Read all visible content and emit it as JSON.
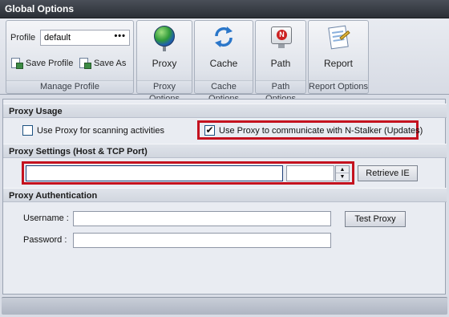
{
  "window": {
    "title": "Global Options"
  },
  "ribbon": {
    "manage_profile": {
      "profile_label": "Profile",
      "profile_value": "default",
      "browse_label": "•••",
      "save_profile_label": "Save Profile",
      "save_as_label": "Save As",
      "group_label": "Manage Profile"
    },
    "proxy": {
      "button_label": "Proxy",
      "group_label": "Proxy Options",
      "icon": "globe-icon"
    },
    "cache": {
      "button_label": "Cache",
      "group_label": "Cache Options",
      "icon": "refresh-arrows-icon"
    },
    "path": {
      "button_label": "Path",
      "group_label": "Path Options",
      "icon": "monitor-icon"
    },
    "report": {
      "button_label": "Report",
      "group_label": "Report Options",
      "icon": "document-pen-icon"
    }
  },
  "proxy_usage": {
    "heading": "Proxy Usage",
    "scanning": {
      "label": "Use Proxy for scanning activities",
      "checked": false
    },
    "updates": {
      "label": "Use Proxy to communicate with N-Stalker (Updates)",
      "checked": true,
      "check_glyph": "✔"
    }
  },
  "proxy_settings": {
    "heading": "Proxy Settings (Host & TCP Port)",
    "host_value": "",
    "port_value": "",
    "spinner_up": "▲",
    "spinner_down": "▼",
    "retrieve_ie_label": "Retrieve IE"
  },
  "proxy_auth": {
    "heading": "Proxy Authentication",
    "username_label": "Username :",
    "username_value": "",
    "password_label": "Password :",
    "password_value": "",
    "test_proxy_label": "Test Proxy"
  },
  "colors": {
    "highlight": "#c4121f",
    "title_bar": "#2b2f36"
  }
}
